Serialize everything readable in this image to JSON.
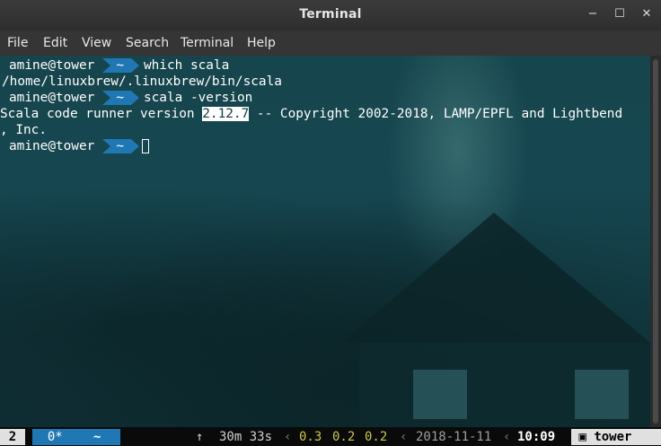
{
  "window": {
    "title": "Terminal",
    "minimize_glyph": "−",
    "maximize_glyph": "☐",
    "close_glyph": "✕"
  },
  "menu": [
    "File",
    "Edit",
    "View",
    "Search",
    "Terminal",
    "Help"
  ],
  "terminal": {
    "prompt_host": "amine@tower",
    "prompt_dir": "~",
    "line1_cmd": "which scala",
    "line2_out": "/home/linuxbrew/.linuxbrew/bin/scala",
    "line3_cmd": "scala -version",
    "line4_pre": "Scala code runner version ",
    "line4_highlight": "2.12.7",
    "line4_post": " -- Copyright 2002-2018, LAMP/EPFL and Lightbend",
    "line5_out": ", Inc."
  },
  "statusbar": {
    "session": "2",
    "window_label": "0*",
    "path": "~",
    "up_arrow": "↑",
    "duration": "30m 33s",
    "load_1": "0.3",
    "load_2": "0.2",
    "load_3": "0.2",
    "date": "2018-11-11",
    "time": "10:09",
    "lock_glyph": "🔒",
    "hostname": "tower"
  },
  "colors": {
    "accent": "#1f78b4",
    "terminal_bg": "#164650"
  }
}
